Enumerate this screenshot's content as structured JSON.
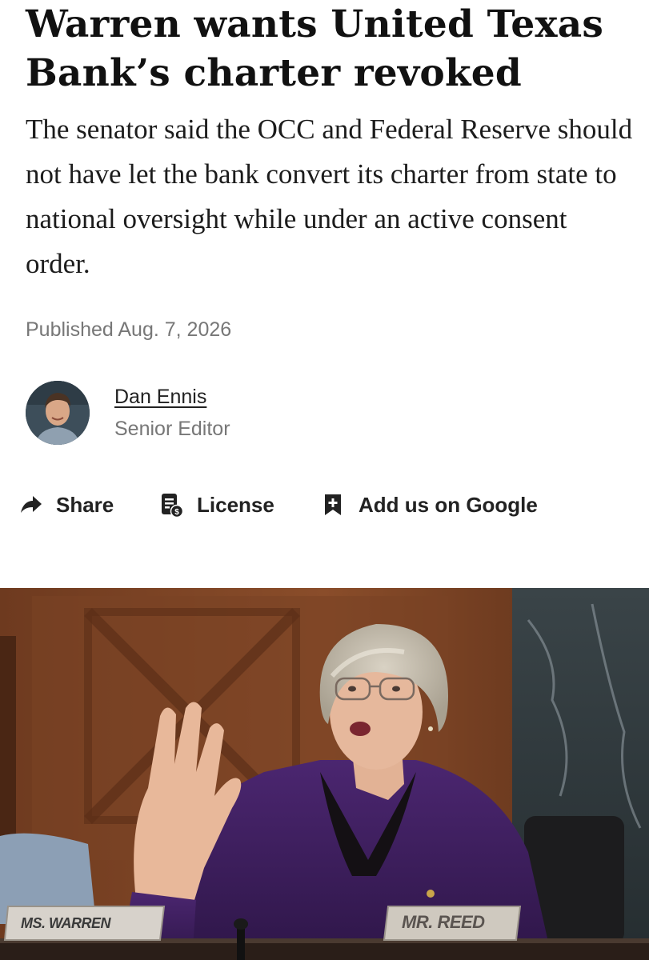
{
  "article": {
    "headline": "Warren wants United Texas Bank’s charter revoked",
    "dek": "The senator said the OCC and Federal Reserve should not have let the bank convert its charter from state to national oversight while under an active consent order.",
    "published": "Published Aug. 7, 2026"
  },
  "author": {
    "name": "Dan Ennis",
    "title": "Senior Editor"
  },
  "actions": [
    {
      "label": "Share",
      "icon": "share-arrow-icon"
    },
    {
      "label": "License",
      "icon": "license-document-icon"
    },
    {
      "label": "Add us on Google",
      "icon": "bookmark-plus-icon"
    }
  ],
  "photo": {
    "nameplate_left": "MS. WARREN",
    "nameplate_right": "MR. REED"
  },
  "colors": {
    "text": "#111111",
    "muted": "#777777",
    "jacket": "#3d1f5c"
  }
}
